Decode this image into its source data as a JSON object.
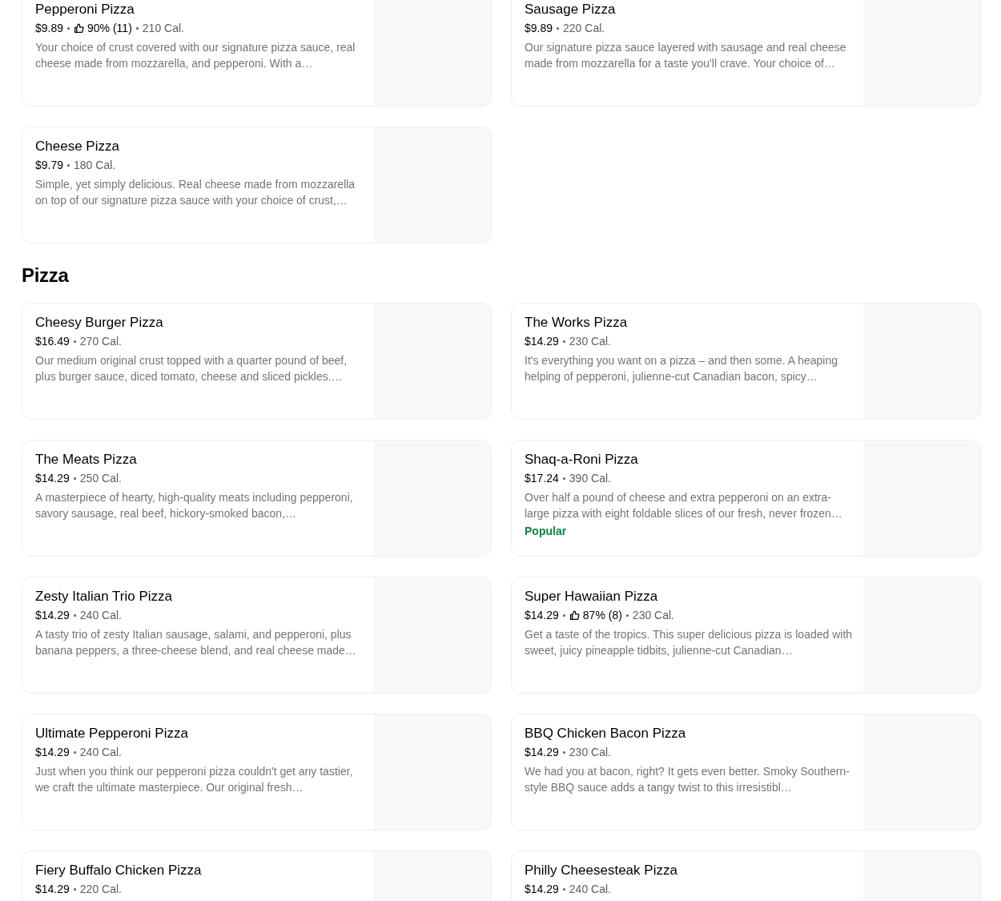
{
  "sections": [
    {
      "items": [
        {
          "name": "Pepperoni Pizza",
          "price": "$9.89",
          "rating": "90% (11)",
          "calories": "210 Cal.",
          "description": "Your choice of crust covered with our signature pizza sauce, real cheese made from mozzarella, and pepperoni. With a…"
        },
        {
          "name": "Sausage Pizza",
          "price": "$9.89",
          "calories": "220 Cal.",
          "description": "Our signature pizza sauce layered with sausage and real cheese made from mozzarella for a taste you'll crave. Your choice of…"
        },
        {
          "name": "Cheese Pizza",
          "price": "$9.79",
          "calories": "180 Cal.",
          "description": "Simple, yet simply delicious. Real cheese made from mozzarella on top of our signature pizza sauce with your choice of crust,…"
        }
      ]
    },
    {
      "title": "Pizza",
      "items": [
        {
          "name": "Cheesy Burger Pizza",
          "price": "$16.49",
          "calories": "270 Cal.",
          "description": "Our medium original crust topped with a quarter pound of beef, plus burger sauce, diced tomato, cheese and sliced pickles.…"
        },
        {
          "name": "The Works Pizza",
          "price": "$14.29",
          "calories": "230 Cal.",
          "description": "It's everything you want on a pizza – and then some. A heaping helping of pepperoni, julienne-cut Canadian bacon, spicy…"
        },
        {
          "name": "The Meats Pizza",
          "price": "$14.29",
          "calories": "250 Cal.",
          "description": "A masterpiece of hearty, high-quality meats including pepperoni, savory sausage, real beef, hickory-smoked bacon,…"
        },
        {
          "name": "Shaq-a-Roni Pizza",
          "price": "$17.24",
          "calories": "390 Cal.",
          "description": "Over half a pound of cheese and extra pepperoni on an extra-large pizza with eight foldable slices of our fresh, never frozen…",
          "badge": "Popular"
        },
        {
          "name": "Zesty Italian Trio Pizza",
          "price": "$14.29",
          "calories": "240 Cal.",
          "description": "A tasty trio of zesty Italian sausage, salami, and pepperoni, plus banana peppers, a three-cheese blend, and real cheese made…"
        },
        {
          "name": "Super Hawaiian Pizza",
          "price": "$14.29",
          "rating": "87% (8)",
          "calories": "230 Cal.",
          "description": "Get a taste of the tropics. This super delicious pizza is loaded with sweet, juicy pineapple tidbits, julienne-cut Canadian…"
        },
        {
          "name": "Ultimate Pepperoni Pizza",
          "price": "$14.29",
          "calories": "240 Cal.",
          "description": "Just when you think our pepperoni pizza couldn't get any tastier, we craft the ultimate masterpiece. Our original fresh…"
        },
        {
          "name": "BBQ Chicken Bacon Pizza",
          "price": "$14.29",
          "calories": "230 Cal.",
          "description": "We had you at bacon, right? It gets even better. Smoky Southern-style BBQ sauce adds a tangy twist to this irresistibl…"
        },
        {
          "name": "Fiery Buffalo Chicken Pizza",
          "price": "$14.29",
          "calories": "220 Cal."
        },
        {
          "name": "Philly Cheesesteak Pizza",
          "price": "$14.29",
          "calories": "240 Cal."
        }
      ]
    }
  ]
}
